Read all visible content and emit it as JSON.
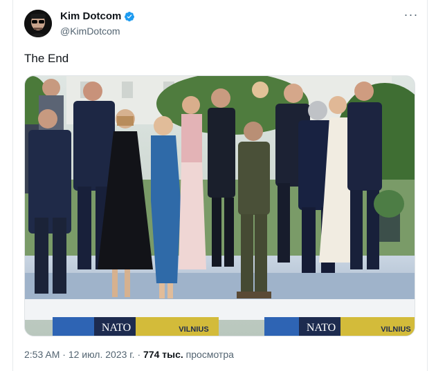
{
  "author": {
    "display_name": "Kim Dotcom",
    "handle": "@KimDotcom",
    "verified": true,
    "avatar_icon": "avatar-photo"
  },
  "post": {
    "text": "The End",
    "media_icon": "photo-group-nato-summit",
    "banner_left": "NATO",
    "banner_left_city": "VILNIUS",
    "banner_right": "NATO",
    "banner_right_city": "VILNIUS"
  },
  "meta": {
    "time": "2:53 AM",
    "separator": "·",
    "date": "12 июл. 2023 г.",
    "views_count": "774 тыс.",
    "views_label": "просмотра"
  },
  "colors": {
    "verified_blue": "#1d9bf0",
    "text_primary": "#0f1419",
    "text_secondary": "#536471"
  }
}
